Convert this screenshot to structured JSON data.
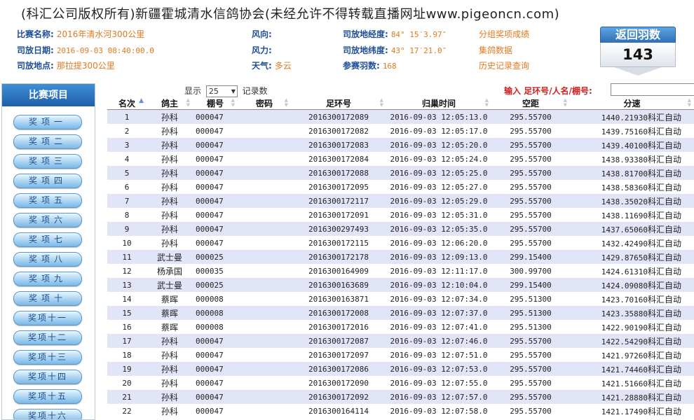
{
  "title": "(科汇公司版权所有)新疆霍城清水信鸽协会(未经允许不得转载直播网址www.pigeoncn.com)",
  "info": {
    "race_name_label": "比赛名称:",
    "race_name": "2016年清水河300公里",
    "release_date_label": "司放日期:",
    "release_date": "2016-09-03 08:40:00.0",
    "release_place_label": "司放地点:",
    "release_place": "那拉提300公里",
    "wind_dir_label": "风向:",
    "wind_dir": "",
    "wind_force_label": "风力:",
    "wind_force": "",
    "weather_label": "天气:",
    "weather": "多云",
    "longitude_label": "司放地经度:",
    "longitude": "84° 15′3.97″",
    "latitude_label": "司放地纬度:",
    "latitude": "43° 17′21.0″",
    "birds_label": "参赛羽数:",
    "birds": "168",
    "link1": "分组奖项成绩",
    "link2": "集鸽数据",
    "link3": "历史记录查询"
  },
  "back_button": {
    "label": "返回羽数",
    "count": "143"
  },
  "sidebar": {
    "title": "比赛项目",
    "items": [
      "奖项一",
      "奖项二",
      "奖项三",
      "奖项四",
      "奖项五",
      "奖项六",
      "奖项七",
      "奖项八",
      "奖项九",
      "奖项十",
      "奖项十一",
      "奖项十二",
      "奖项十三",
      "奖项十四",
      "奖项十五",
      "奖项十六"
    ]
  },
  "controls": {
    "show_label": "显示",
    "page_size": "25",
    "records_label": "记录数"
  },
  "search": {
    "label": "输入 足环号/人名/棚号:"
  },
  "table": {
    "headers": [
      "名次",
      "鸽主",
      "棚号",
      "密码",
      "足环号",
      "归巢时间",
      "空距",
      "分速"
    ],
    "rows": [
      [
        "1",
        "孙科",
        "000047",
        "",
        "2016300172089",
        "2016-09-03 12:05:13.0",
        "295.55700",
        "1440.21930",
        "科汇自动"
      ],
      [
        "2",
        "孙科",
        "000047",
        "",
        "2016300172082",
        "2016-09-03 12:05:17.0",
        "295.55700",
        "1439.75160",
        "科汇自动"
      ],
      [
        "3",
        "孙科",
        "000047",
        "",
        "2016300172083",
        "2016-09-03 12:05:20.0",
        "295.55700",
        "1439.40100",
        "科汇自动"
      ],
      [
        "4",
        "孙科",
        "000047",
        "",
        "2016300172084",
        "2016-09-03 12:05:24.0",
        "295.55700",
        "1438.93380",
        "科汇自动"
      ],
      [
        "5",
        "孙科",
        "000047",
        "",
        "2016300172088",
        "2016-09-03 12:05:25.0",
        "295.55700",
        "1438.81700",
        "科汇自动"
      ],
      [
        "6",
        "孙科",
        "000047",
        "",
        "2016300172095",
        "2016-09-03 12:05:27.0",
        "295.55700",
        "1438.58360",
        "科汇自动"
      ],
      [
        "7",
        "孙科",
        "000047",
        "",
        "2016300172117",
        "2016-09-03 12:05:29.0",
        "295.55700",
        "1438.35020",
        "科汇自动"
      ],
      [
        "8",
        "孙科",
        "000047",
        "",
        "2016300172091",
        "2016-09-03 12:05:31.0",
        "295.55700",
        "1438.11690",
        "科汇自动"
      ],
      [
        "9",
        "孙科",
        "000047",
        "",
        "2016300297493",
        "2016-09-03 12:05:35.0",
        "295.55700",
        "1437.65060",
        "科汇自动"
      ],
      [
        "10",
        "孙科",
        "000047",
        "",
        "2016300172115",
        "2016-09-03 12:06:20.0",
        "295.55700",
        "1432.42490",
        "科汇自动"
      ],
      [
        "11",
        "武士曼",
        "000025",
        "",
        "2016300172178",
        "2016-09-03 12:09:13.0",
        "299.15400",
        "1429.87650",
        "科汇自动"
      ],
      [
        "12",
        "杨承国",
        "000035",
        "",
        "2016300164909",
        "2016-09-03 12:11:17.0",
        "300.99700",
        "1424.61310",
        "科汇自动"
      ],
      [
        "13",
        "武士曼",
        "000025",
        "",
        "2016300163689",
        "2016-09-03 12:10:04.0",
        "299.15400",
        "1424.09080",
        "科汇自动"
      ],
      [
        "14",
        "蔡晖",
        "000008",
        "",
        "2016300163871",
        "2016-09-03 12:07:34.0",
        "295.51300",
        "1423.70160",
        "科汇自动"
      ],
      [
        "15",
        "蔡晖",
        "000008",
        "",
        "2016300172008",
        "2016-09-03 12:07:37.0",
        "295.51300",
        "1423.35880",
        "科汇自动"
      ],
      [
        "16",
        "蔡晖",
        "000008",
        "",
        "2016300172016",
        "2016-09-03 12:07:41.0",
        "295.51300",
        "1422.90190",
        "科汇自动"
      ],
      [
        "17",
        "孙科",
        "000047",
        "",
        "2016300172087",
        "2016-09-03 12:07:46.0",
        "295.55700",
        "1422.54290",
        "科汇自动"
      ],
      [
        "18",
        "孙科",
        "000047",
        "",
        "2016300172097",
        "2016-09-03 12:07:51.0",
        "295.55700",
        "1421.97260",
        "科汇自动"
      ],
      [
        "19",
        "孙科",
        "000047",
        "",
        "2016300172086",
        "2016-09-03 12:07:53.0",
        "295.55700",
        "1421.74460",
        "科汇自动"
      ],
      [
        "20",
        "孙科",
        "000047",
        "",
        "2016300172090",
        "2016-09-03 12:07:55.0",
        "295.55700",
        "1421.51660",
        "科汇自动"
      ],
      [
        "21",
        "孙科",
        "000047",
        "",
        "2016300172092",
        "2016-09-03 12:07:57.0",
        "295.55700",
        "1421.28880",
        "科汇自动"
      ],
      [
        "22",
        "孙科",
        "000047",
        "",
        "2016300164114",
        "2016-09-03 12:07:58.0",
        "295.55700",
        "1421.17490",
        "科汇自动"
      ]
    ]
  },
  "colors": {
    "row_stripe": "#e2e4f8",
    "label_blue": "#1f4e96",
    "value_orange": "#e07a1f",
    "search_red": "#d21f1f"
  }
}
